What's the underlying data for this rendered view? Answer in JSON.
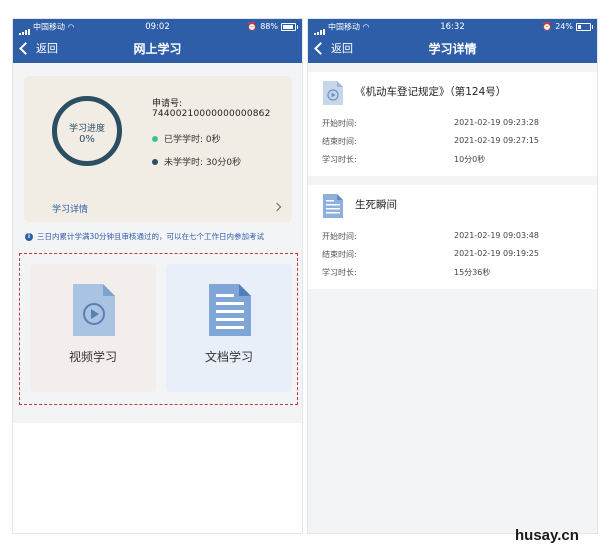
{
  "left": {
    "status": {
      "carrier": "中国移动",
      "time": "09:02",
      "battery": "88%",
      "battery_level": 0.88
    },
    "nav": {
      "back": "返回",
      "title": "网上学习"
    },
    "progress": {
      "ring_label": "学习进度",
      "ring_value": "0%",
      "application_label": "申请号:",
      "application_number": "74400210000000000862",
      "learned": "已学学时:  0秒",
      "unlearned": "未学学时:  30分0秒",
      "detail_link": "学习详情"
    },
    "notice": "三日内累计学满30分钟且审核通过的，可以在七个工作日内参加考试",
    "modules": {
      "video": "视频学习",
      "document": "文档学习"
    }
  },
  "right": {
    "status": {
      "carrier": "中国移动",
      "time": "16:32",
      "battery": "24%",
      "battery_level": 0.24
    },
    "nav": {
      "back": "返回",
      "title": "学习详情"
    },
    "records": [
      {
        "title": "《机动车登记规定》（第124号）",
        "icon": "video-icon",
        "rows": [
          {
            "label": "开始时间:",
            "value": "2021-02-19 09:23:28"
          },
          {
            "label": "结束时间:",
            "value": "2021-02-19 09:27:15"
          },
          {
            "label": "学习时长:",
            "value": "10分0秒"
          }
        ]
      },
      {
        "title": "生死瞬间",
        "icon": "document-icon",
        "rows": [
          {
            "label": "开始时间:",
            "value": "2021-02-19 09:03:48"
          },
          {
            "label": "结束时间:",
            "value": "2021-02-19 09:19:25"
          },
          {
            "label": "学习时长:",
            "value": "15分36秒"
          }
        ]
      }
    ]
  },
  "colors": {
    "header_blue": "#2f5ea8",
    "ring": "#2b4e63",
    "learned_dot": "#3fbf9a",
    "unlearned_dot": "#2b4e63",
    "dashed_border": "#c23a3a"
  },
  "watermark": "husay.cn"
}
